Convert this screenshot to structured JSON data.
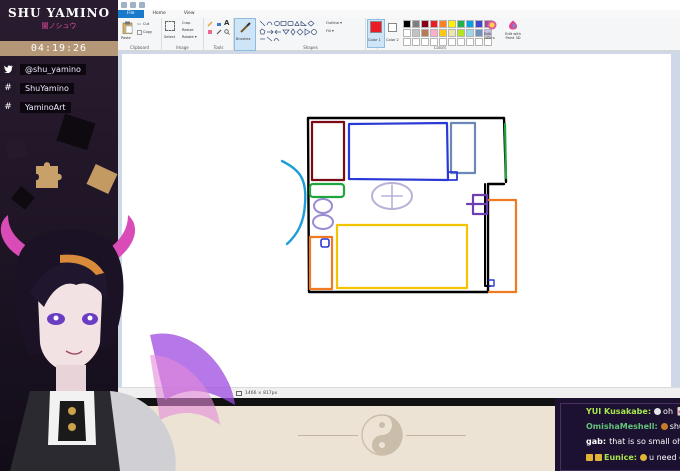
{
  "overlay": {
    "logo_main": "SHU YAMINO",
    "logo_sub": "闇ノシュウ",
    "timer": "04:19:26",
    "socials": [
      {
        "icon": "twitter-icon",
        "text": "@shu_yamino"
      },
      {
        "icon": "hashtag-icon",
        "text": "ShuYamino"
      },
      {
        "icon": "hashtag-icon",
        "text": "YaminoArt"
      }
    ]
  },
  "paint": {
    "menu_tabs": [
      "File",
      "Home",
      "View"
    ],
    "clipboard": {
      "label": "Clipboard",
      "paste": "Paste",
      "cut": "Cut",
      "copy": "Copy"
    },
    "image": {
      "label": "Image",
      "select": "Select",
      "crop": "Crop",
      "resize": "Resize",
      "rotate": "Rotate ▾"
    },
    "tools": {
      "label": "Tools"
    },
    "brushes": {
      "label": "Brushes"
    },
    "shapes": {
      "label": "Shapes",
      "outline": "Outline ▾",
      "fill": "Fill ▾"
    },
    "size": {
      "label": "Size"
    },
    "colors": {
      "label": "Colors",
      "color1": "Color 1",
      "color2": "Color 2",
      "edit_colors": "Edit colors"
    },
    "paint3d": {
      "label": "Edit with Paint 3D"
    },
    "palette": [
      "#000000",
      "#7f7f7f",
      "#880015",
      "#ed1c24",
      "#ff7f27",
      "#fff200",
      "#22b14c",
      "#00a2e8",
      "#3f48cc",
      "#a349a4",
      "#ffffff",
      "#c3c3c3",
      "#b97a57",
      "#ffaec9",
      "#ffc90e",
      "#efe4b0",
      "#b5e61d",
      "#99d9ea",
      "#7092be",
      "#c8bfe7",
      "#ffffff",
      "#ffffff",
      "#ffffff",
      "#ffffff",
      "#ffffff",
      "#ffffff",
      "#ffffff",
      "#ffffff",
      "#ffffff",
      "#ffffff"
    ],
    "status": "1466 × 817px",
    "colors_used": {
      "black": "#000000",
      "dark_red": "#7a0a14",
      "blue": "#2a39d6",
      "steel": "#6a89b8",
      "green": "#1fa53b",
      "cyan": "#1e9ed6",
      "lavender": "#9a8ad4",
      "purple": "#6d3fb3",
      "gray_lavender": "#b9b0d8",
      "orange": "#f07a22",
      "yellow": "#f5c400"
    }
  },
  "chat": [
    {
      "user": "YUI Kusakabe:",
      "user_color": "#a8e64e",
      "emote": "#e5e5e5",
      "msg": "oh 🀄"
    },
    {
      "user": "OmishaMeshell:",
      "user_color": "#63c27a",
      "emote": "#c77a2a",
      "msg": "shu i"
    },
    {
      "user": "gab:",
      "user_color": "#ffffff",
      "emote": "",
      "msg": "that is so small oh no"
    },
    {
      "user": "Eunice:",
      "user_color": "#a8e64e",
      "emote": "#e0b535",
      "msg": "u need c"
    }
  ]
}
